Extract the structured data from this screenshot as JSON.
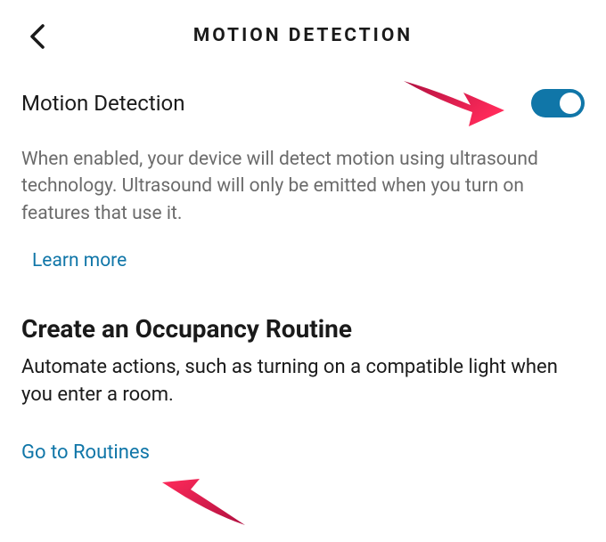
{
  "header": {
    "title": "MOTION DETECTION"
  },
  "settings": {
    "motionDetection": {
      "label": "Motion Detection",
      "enabled": true,
      "description": "When enabled, your device will detect motion using ultrasound technology. Ultrasound will only be emitted when you turn on features that use it.",
      "learnMoreLabel": "Learn more"
    }
  },
  "occupancy": {
    "heading": "Create an Occupancy Routine",
    "description": "Automate actions, such as turning on a compatible light when you enter a room.",
    "linkLabel": "Go to Routines"
  },
  "colors": {
    "accent": "#1076a8",
    "text": "#1a1a1a",
    "muted": "#6b6b6b",
    "annotation": "#d91e50"
  }
}
